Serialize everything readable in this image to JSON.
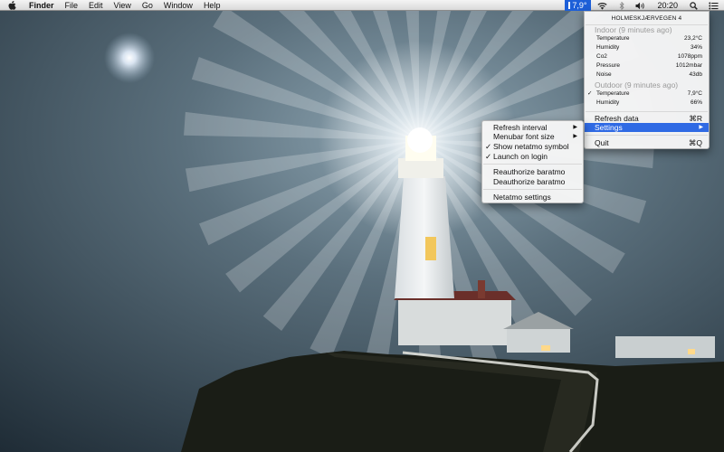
{
  "menubar": {
    "apple_icon": "apple-icon",
    "app_name": "Finder",
    "menus": [
      "File",
      "Edit",
      "View",
      "Go",
      "Window",
      "Help"
    ],
    "netatmo_value": "7,9°",
    "clock": "20:20",
    "status_icons": [
      "wifi-icon",
      "bluetooth-icon",
      "volume-icon",
      "search-icon",
      "list-icon"
    ]
  },
  "netatmo_menu": {
    "station": "HOLMESKJÆRVEGEN 4",
    "indoor": {
      "title": "Indoor (9 minutes ago)",
      "rows": [
        {
          "label": "Temperature",
          "value": "23,2°C"
        },
        {
          "label": "Humidity",
          "value": "34%"
        },
        {
          "label": "Co2",
          "value": "1078ppm"
        },
        {
          "label": "Pressure",
          "value": "1012mbar"
        },
        {
          "label": "Noise",
          "value": "43db"
        }
      ]
    },
    "outdoor": {
      "title": "Outdoor (9 minutes ago)",
      "rows": [
        {
          "label": "Temperature",
          "value": "7,9°C",
          "checked": true
        },
        {
          "label": "Humidity",
          "value": "66%"
        }
      ]
    },
    "refresh_label": "Refresh data",
    "refresh_shortcut": "⌘R",
    "settings_label": "Settings",
    "quit_label": "Quit",
    "quit_shortcut": "⌘Q"
  },
  "settings_submenu": {
    "items": [
      {
        "label": "Refresh interval",
        "has_submenu": true
      },
      {
        "label": "Menubar font size",
        "has_submenu": true
      },
      {
        "label": "Show netatmo symbol",
        "checked": true
      },
      {
        "label": "Launch on login",
        "checked": true
      },
      {
        "label": "Reauthorize baratmo"
      },
      {
        "label": "Deauthorize baratmo"
      },
      {
        "label": "Netatmo settings"
      }
    ]
  }
}
